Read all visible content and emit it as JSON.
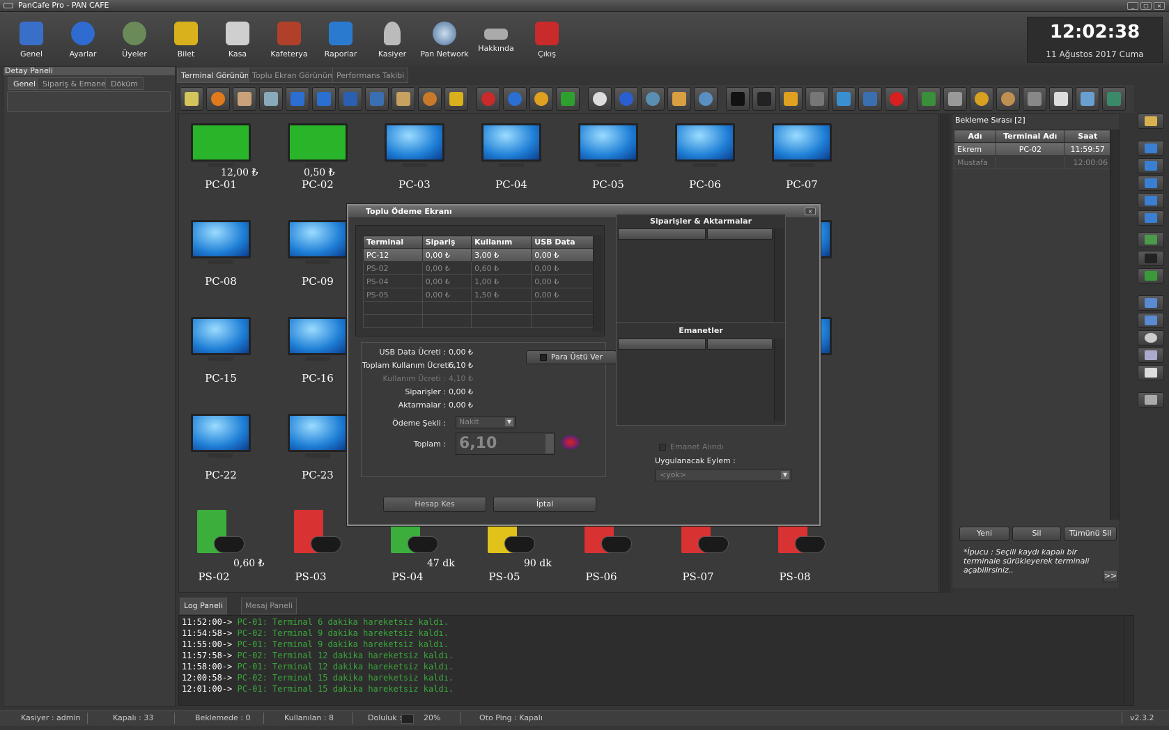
{
  "window": {
    "title": "PanCafe Pro - PAN CAFE",
    "min": "_",
    "max": "□",
    "close": "×"
  },
  "toolbar": [
    {
      "label": "Genel"
    },
    {
      "label": "Ayarlar"
    },
    {
      "label": "Üyeler"
    },
    {
      "label": "Bilet"
    },
    {
      "label": "Kasa"
    },
    {
      "label": "Kafeterya"
    },
    {
      "label": "Raporlar"
    },
    {
      "label": "Kasiyer"
    },
    {
      "label": "Pan Network"
    },
    {
      "label": "Hakkında"
    },
    {
      "label": "Çıkış"
    }
  ],
  "clock": {
    "time": "12:02:38",
    "date": "11 Ağustos 2017 Cuma"
  },
  "left_panel": {
    "title": "Detay Paneli",
    "tabs": [
      "Genel",
      "Sipariş & Emanet",
      "Döküm"
    ]
  },
  "center_tabs": [
    "Terminal Görünümü",
    "Toplu Ekran Görünümü",
    "Performans Takibi"
  ],
  "terminals": [
    {
      "name": "PC-01",
      "extra": "12,00 ₺",
      "state": "green"
    },
    {
      "name": "PC-02",
      "extra": "0,50 ₺",
      "state": "green"
    },
    {
      "name": "PC-03",
      "extra": ""
    },
    {
      "name": "PC-04",
      "extra": ""
    },
    {
      "name": "PC-05",
      "extra": ""
    },
    {
      "name": "PC-06",
      "extra": ""
    },
    {
      "name": "PC-07",
      "extra": ""
    },
    {
      "name": "PC-08",
      "extra": ""
    },
    {
      "name": "PC-09",
      "extra": ""
    },
    {
      "name": "PC-15",
      "extra": ""
    },
    {
      "name": "PC-16",
      "extra": ""
    },
    {
      "name": "PC-22",
      "extra": ""
    },
    {
      "name": "PC-23",
      "extra": ""
    }
  ],
  "consoles": [
    {
      "name": "PS-02",
      "extra": "0,60 ₺",
      "color": "green"
    },
    {
      "name": "PS-03",
      "extra": "",
      "color": "red"
    },
    {
      "name": "PS-04",
      "extra": "47 dk",
      "color": "green"
    },
    {
      "name": "PS-05",
      "extra": "90 dk",
      "color": "yellow"
    },
    {
      "name": "PS-06",
      "extra": "",
      "color": "red"
    },
    {
      "name": "PS-07",
      "extra": "",
      "color": "red"
    },
    {
      "name": "PS-08",
      "extra": "",
      "color": "red"
    }
  ],
  "queue": {
    "title": "Bekleme Sırası [2]",
    "columns": [
      "Adı",
      "Terminal Adı",
      "Saat"
    ],
    "rows": [
      [
        "Ekrem",
        "PC-02",
        "11:59:57"
      ],
      [
        "Mustafa",
        "",
        "12:00:06"
      ]
    ],
    "buttons": {
      "new": "Yeni",
      "delete": "Sil",
      "delete_all": "Tümünü Sil",
      "more": ">>"
    },
    "tip": "*İpucu : Seçili kaydı kapalı bir terminale sürükleyerek terminali açabilirsiniz.."
  },
  "dialog": {
    "title": "Toplu Ödeme Ekranı",
    "columns": [
      "Terminal",
      "Sipariş",
      "Kullanım",
      "USB Data"
    ],
    "rows": [
      [
        "PC-12",
        "0,00 ₺",
        "3,00 ₺",
        "0,00 ₺"
      ],
      [
        "PS-02",
        "0,00 ₺",
        "0,60 ₺",
        "0,00 ₺"
      ],
      [
        "PS-04",
        "0,00 ₺",
        "1,00 ₺",
        "0,00 ₺"
      ],
      [
        "PS-05",
        "0,00 ₺",
        "1,50 ₺",
        "0,00 ₺"
      ]
    ],
    "orders_title": "Siparişler & Aktarmalar",
    "deposits_title": "Emanetler",
    "fields": [
      {
        "label": "USB Data Ücreti :",
        "value": "0,00 ₺"
      },
      {
        "label": "Toplam Kullanım Ücreti :",
        "value": "6,10 ₺"
      },
      {
        "label": "Kullanım Ücreti :",
        "value": "4,10 ₺"
      },
      {
        "label": "Siparişler :",
        "value": "0,00 ₺"
      },
      {
        "label": "Aktarmalar :",
        "value": "0,00 ₺"
      }
    ],
    "change_label": "Para Üstü Ver",
    "payment_label": "Ödeme Şekli :",
    "payment_value": "Nakit",
    "total_label": "Toplam :",
    "total_value": "6,10",
    "deposit_taken": "Emanet Alındı",
    "action_label": "Uygulanacak Eylem :",
    "action_value": "<yok>",
    "btn_ok": "Hesap Kes",
    "btn_cancel": "İptal"
  },
  "log": {
    "tabs": [
      "Log Paneli",
      "Mesaj Paneli"
    ],
    "lines": [
      {
        "time": "11:52:00->",
        "msg": "PC-01: Terminal 6 dakika hareketsiz kaldı."
      },
      {
        "time": "11:54:58->",
        "msg": "PC-02: Terminal 9 dakika hareketsiz kaldı."
      },
      {
        "time": "11:55:00->",
        "msg": "PC-01: Terminal 9 dakika hareketsiz kaldı."
      },
      {
        "time": "11:57:58->",
        "msg": "PC-02: Terminal 12 dakika hareketsiz kaldı."
      },
      {
        "time": "11:58:00->",
        "msg": "PC-01: Terminal 12 dakika hareketsiz kaldı."
      },
      {
        "time": "12:00:58->",
        "msg": "PC-02: Terminal 15 dakika hareketsiz kaldı."
      },
      {
        "time": "12:01:00->",
        "msg": "PC-01: Terminal 15 dakika hareketsiz kaldı."
      }
    ]
  },
  "status": {
    "cashier": "Kasiyer : admin",
    "closed": "Kapalı : 33",
    "waiting": "Beklemede : 0",
    "used": "Kullanılan : 8",
    "occupancy_label": "Doluluk :",
    "occupancy": "20%",
    "ping": "Oto Ping : Kapalı",
    "version": "v2.3.2"
  },
  "colors": {
    "green": "#29b529",
    "red": "#d83232",
    "yellow": "#e0c21a",
    "log_green": "#3aa63a"
  }
}
